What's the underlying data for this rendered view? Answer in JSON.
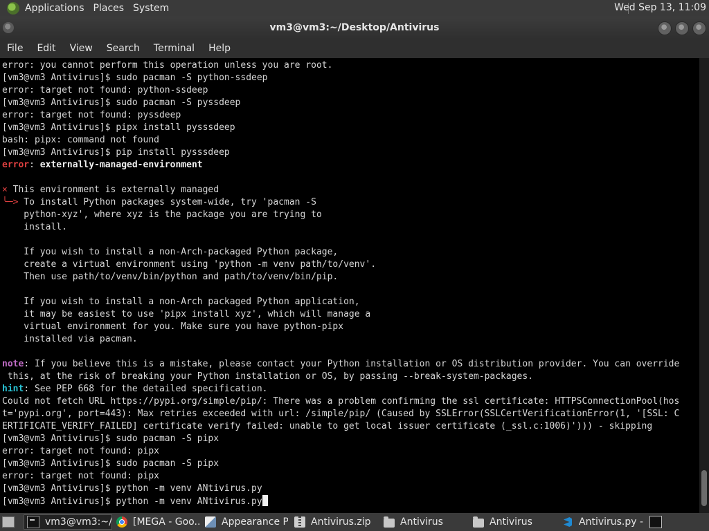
{
  "top_panel": {
    "menu": [
      "Applications",
      "Places",
      "System"
    ],
    "clock": "Wed Sep 13, 11:09"
  },
  "window": {
    "title": "vm3@vm3:~/Desktop/Antivirus"
  },
  "menubar": [
    "File",
    "Edit",
    "View",
    "Search",
    "Terminal",
    "Help"
  ],
  "terminal": {
    "lines": [
      [
        {
          "t": "error: you cannot perform this operation unless you are root."
        }
      ],
      [
        {
          "t": "[vm3@vm3 Antivirus]$ sudo pacman -S python-ssdeep"
        }
      ],
      [
        {
          "t": "error: target not found: python-ssdeep"
        }
      ],
      [
        {
          "t": "[vm3@vm3 Antivirus]$ sudo pacman -S pyssdeep"
        }
      ],
      [
        {
          "t": "error: target not found: pyssdeep"
        }
      ],
      [
        {
          "t": "[vm3@vm3 Antivirus]$ pipx install pysssdeep"
        }
      ],
      [
        {
          "t": "bash: pipx: command not found"
        }
      ],
      [
        {
          "t": "[vm3@vm3 Antivirus]$ pip install pysssdeep"
        }
      ],
      [
        {
          "t": "error",
          "c": "err"
        },
        {
          "t": ": "
        },
        {
          "t": "externally-managed-environment",
          "c": "bold"
        }
      ],
      [
        {
          "t": ""
        }
      ],
      [
        {
          "t": "×",
          "c": "arrow"
        },
        {
          "t": " This environment is externally managed"
        }
      ],
      [
        {
          "t": "╰─>",
          "c": "arrow"
        },
        {
          "t": " To install Python packages system-wide, try 'pacman -S"
        }
      ],
      [
        {
          "t": "    python-xyz', where xyz is the package you are trying to"
        }
      ],
      [
        {
          "t": "    install."
        }
      ],
      [
        {
          "t": ""
        }
      ],
      [
        {
          "t": "    If you wish to install a non-Arch-packaged Python package,"
        }
      ],
      [
        {
          "t": "    create a virtual environment using 'python -m venv path/to/venv'."
        }
      ],
      [
        {
          "t": "    Then use path/to/venv/bin/python and path/to/venv/bin/pip."
        }
      ],
      [
        {
          "t": ""
        }
      ],
      [
        {
          "t": "    If you wish to install a non-Arch packaged Python application,"
        }
      ],
      [
        {
          "t": "    it may be easiest to use 'pipx install xyz', which will manage a"
        }
      ],
      [
        {
          "t": "    virtual environment for you. Make sure you have python-pipx"
        }
      ],
      [
        {
          "t": "    installed via pacman."
        }
      ],
      [
        {
          "t": ""
        }
      ],
      [
        {
          "t": "note",
          "c": "note"
        },
        {
          "t": ": If you believe this is a mistake, please contact your Python installation or OS distribution provider. You can override"
        }
      ],
      [
        {
          "t": " this, at the risk of breaking your Python installation or OS, by passing --break-system-packages."
        }
      ],
      [
        {
          "t": "hint",
          "c": "hint"
        },
        {
          "t": ": See PEP 668 for the detailed specification."
        }
      ],
      [
        {
          "t": "Could not fetch URL https://pypi.org/simple/pip/: There was a problem confirming the ssl certificate: HTTPSConnectionPool(hos"
        }
      ],
      [
        {
          "t": "t='pypi.org', port=443): Max retries exceeded with url: /simple/pip/ (Caused by SSLError(SSLCertVerificationError(1, '[SSL: C"
        }
      ],
      [
        {
          "t": "ERTIFICATE_VERIFY_FAILED] certificate verify failed: unable to get local issuer certificate (_ssl.c:1006)'))) - skipping"
        }
      ],
      [
        {
          "t": "[vm3@vm3 Antivirus]$ sudo pacman -S pipx"
        }
      ],
      [
        {
          "t": "error: target not found: pipx"
        }
      ],
      [
        {
          "t": "[vm3@vm3 Antivirus]$ sudo pacman -S pipx"
        }
      ],
      [
        {
          "t": "error: target not found: pipx"
        }
      ],
      [
        {
          "t": "[vm3@vm3 Antivirus]$ python -m venv ANtivirus.py"
        }
      ],
      [
        {
          "t": "[vm3@vm3 Antivirus]$ python -m venv ANtivirus.py"
        }
      ]
    ]
  },
  "taskbar": {
    "tasks": [
      {
        "label": "vm3@vm3:~/...",
        "icon": "terminal-icon",
        "active": true
      },
      {
        "label": "[MEGA - Goo...",
        "icon": "chrome-icon"
      },
      {
        "label": "Appearance P...",
        "icon": "appearance-icon"
      },
      {
        "label": "Antivirus.zip",
        "icon": "zip-icon"
      },
      {
        "label": "Antivirus",
        "icon": "folder-icon"
      },
      {
        "label": "Antivirus",
        "icon": "folder-icon"
      },
      {
        "label": "Antivirus.py - ...",
        "icon": "vscode-icon"
      }
    ]
  }
}
